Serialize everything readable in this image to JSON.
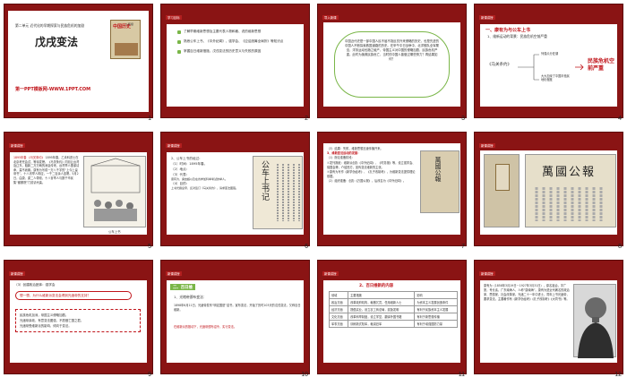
{
  "slides": [
    {
      "number": "1",
      "chapter": "第二单元 近代化的早期探索与民族危机的加剧",
      "title": "戊戌变法",
      "footer": "第一PPT模板网-WWW.1PPT.COM",
      "book_title": "中国历史",
      "book_grade": "八年级"
    },
    {
      "number": "2",
      "section": "学习目标",
      "items": [
        "了解早期维新思想及主要代表人物和著、说的维新思想",
        "熟悉公车上书、《中外纪闻》、强学会、《应诏统筹全局折》等知识点",
        "掌握百日维新措施，戊戌变法的历史意义与失败的原因"
      ]
    },
    {
      "number": "3",
      "section": "导入新课",
      "passage": "中国近代史是一部中国人民不屈不挠反抗外来侵略的历史，也是先进的中国人不断探索救国道路的历史。在甲午中日战争中，北洋舰队全军覆没，洋务运动也随之破产，帝国主义对中国的侵略加剧，民族危机严重。此时为挽救民族危亡，当时的中国人曾做过哪些努力？再结果如何？"
    },
    {
      "number": "4",
      "section": "新课讲授",
      "heading": "一、康有为与公车上书",
      "subheading": "1、维新运动的背景：民族危机空前严重",
      "treaty": "《马关条约》",
      "branch1": "列强瓜分狂潮",
      "branch2": "大大加深了中国半殖民地化程度",
      "result": "民族危机空前严重"
    },
    {
      "number": "5",
      "section": "新课讲授",
      "paragraph": "1895年春，乙未科进士在北京考完会试，等待发榜。《马关条约》内割让台湾及辽东，赔款二万万两的消息传来，台湾举人垂涕请命，莫不哀痛。康有为写成一万八千字的“上今上皇帝书”，十八省举人响应，一千二百余人连署。5月2日，由康、梁二人带领，十八省举人与数千市民集“都察院”门前请代奏。",
      "highlight1": "1895年春",
      "highlight2": "《马关条约》",
      "caption": "公车上书"
    },
    {
      "number": "6",
      "section": "新课讲授",
      "lines": [
        "2、公车上书的经过：",
        "（1）时间：1895年春。",
        "（2）地点：",
        "（3）代表：",
        "康有为、梁启超以及在省参加科举考试的举人。",
        "（4）目的：",
        "上书光绪皇帝，反对签订《马关条约》，请求变法图强。"
      ],
      "paper_title": "公车上书记"
    },
    {
      "number": "7",
      "section": "新课讲授",
      "lines": [
        "（3）结果：失败，维新思想迅速传播开来。",
        "3、维新变法运动的发展：",
        "（1）舆论准备阶段：",
        "①发刊报纸：维新派创办《中外纪闻》、《时务报》等，设立强学会、保国会等，介绍西方，宣传变法维新的主张。",
        "②康有为写作《新学伪经考》、《孔子改制考》，为维新变法提供理论依据。",
        "（2）组织准备：创办《万国公报》，后改名为《中外纪闻》。"
      ],
      "paper_title": "萬國公報"
    },
    {
      "number": "8",
      "section": "新课讲授",
      "image_label": "萬國公報"
    },
    {
      "number": "9",
      "section": "新课讲授",
      "question_intro": "（3）创建政治团体：强学会",
      "question": "想一想，为什么维新派变法会得到光绪帝的支持？",
      "answers": [
        "民族危机加深，帝国主义侵略加剧。",
        "光绪帝亲政，有意变法图强，不愿做亡国之君。",
        "光绪帝受维新派的影响，倾向于变法。"
      ]
    },
    {
      "number": "10",
      "section": "新课讲授",
      "heading": "二、百日维新",
      "subheading": "1、光绪帝颁布变法：",
      "paragraph": "1898年6月11日，光绪帝发布“明定国是”诏书，宣布变法，开始了历时103天的戊戌变法，又称百日维新。",
      "note": "在维新派的推动下，光绪帝颁布诏令，实行变法。"
    },
    {
      "number": "11",
      "section": "新课讲授",
      "heading": "2、百日维新的内容",
      "table_headers": [
        "领域",
        "主要措施",
        "影响"
      ],
      "table_rows": [
        [
          "政治方面",
          "改革政府机构，裁撤冗员，任用维新人士",
          "为资本主义发展创造条件"
        ],
        [
          "经济方面",
          "提倡实业，设立农工商总局，奖励发明",
          "有利于民族资本主义发展"
        ],
        [
          "文化方面",
          "改革科举制度，设立学堂，翻译外国书籍",
          "有利于新思想传播"
        ],
        [
          "军事方面",
          "训练新式陆军，裁减旧军",
          "有利于增强国防力量"
        ]
      ]
    },
    {
      "number": "12",
      "section": "新课讲授",
      "paragraph": "康有为（1858年3月19日－1927年3月31日），原名祖诒，字广厦，号长素，广东南海人，人称“康南海”。康有为是近代著名的政治家、思想家、社会改革家。光绪二十一年中进士，同年上书光绪帝，要求变法。主要著作有《新学伪经考》《孔子改制考》《大同书》等。"
    }
  ],
  "colors": {
    "frame": "#8a1414",
    "accent": "#c0141a",
    "bullet": "#7ab648"
  },
  "icons": {
    "slide4_arrow": "arrow-right-icon",
    "slide9_callout": "speech-bubble-icon"
  }
}
